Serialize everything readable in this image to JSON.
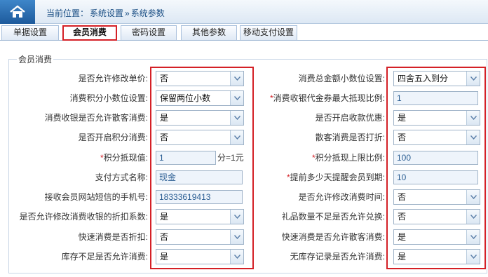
{
  "breadcrumb": {
    "prefix": "当前位置：",
    "level1": "系统设置",
    "separator": "»",
    "level2": "系统参数"
  },
  "tabs": [
    {
      "label": "单据设置"
    },
    {
      "label": "会员消费"
    },
    {
      "label": "密码设置"
    },
    {
      "label": "其他参数"
    },
    {
      "label": "移动支付设置"
    }
  ],
  "section_title": "会员消费",
  "left": [
    {
      "label": "是否允许修改单价:",
      "value": "否"
    },
    {
      "label": "消费积分小数位设置:",
      "value": "保留两位小数"
    },
    {
      "label": "消费收银是否允许散客消费:",
      "value": "是"
    },
    {
      "label": "是否开启积分消费:",
      "value": "否"
    },
    {
      "label": "积分抵现值:",
      "value": "1",
      "required": "*",
      "suffix": "分=1元"
    },
    {
      "label": "支付方式名称:",
      "value": "现金"
    },
    {
      "label": "接收会员网站短信的手机号:",
      "value": "18333619413"
    },
    {
      "label": "是否允许修改消费收银的折扣系数:",
      "value": "是"
    },
    {
      "label": "快速消费是否折扣:",
      "value": "否"
    },
    {
      "label": "库存不足是否允许消费:",
      "value": "是"
    }
  ],
  "right": [
    {
      "label": "消费总金额小数位设置:",
      "value": "四舍五入到分"
    },
    {
      "label": "消费收银代金券最大抵现比例:",
      "value": "1",
      "required": "*"
    },
    {
      "label": "是否开启收款优惠:",
      "value": "是"
    },
    {
      "label": "散客消费是否打折:",
      "value": "否"
    },
    {
      "label": "积分抵现上限比例:",
      "value": "100",
      "required": "*"
    },
    {
      "label": "提前多少天提醒会员到期:",
      "value": "10",
      "required": "*"
    },
    {
      "label": "是否允许修改消费时间:",
      "value": "否"
    },
    {
      "label": "礼品数量不足是否允许兑换:",
      "value": "否"
    },
    {
      "label": "快速消费是否允许散客消费:",
      "value": "是"
    },
    {
      "label": "无库存记录是否允许消费:",
      "value": "是"
    }
  ],
  "icons": {
    "home": "home-icon",
    "dropdown": "chevron-down-icon"
  },
  "colors": {
    "highlight": "#d42026",
    "accent": "#1d5a9c"
  }
}
